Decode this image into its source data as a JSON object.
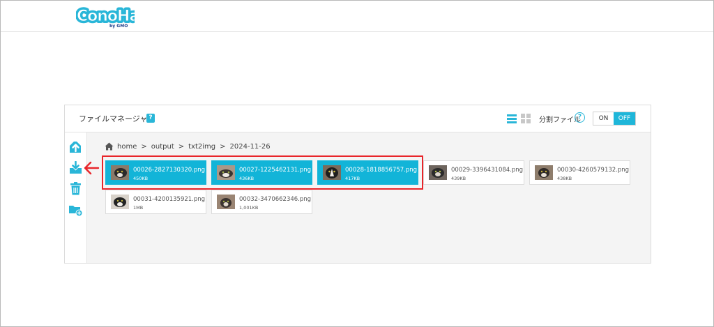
{
  "brand": {
    "logo_text": "ConoHa",
    "logo_sub": "by GMO",
    "color": "#29b6d8"
  },
  "panel": {
    "title": "ファイルマネージャー",
    "help_glyph": "?",
    "split_label": "分割ファイル",
    "split_help_glyph": "?",
    "toggle": {
      "on_label": "ON",
      "off_label": "OFF",
      "selected": "OFF"
    }
  },
  "sidebar": {
    "buttons": [
      {
        "name": "upload-icon",
        "active": false
      },
      {
        "name": "download-icon",
        "active": true
      },
      {
        "name": "trash-icon",
        "active": false
      },
      {
        "name": "new-folder-icon",
        "active": false
      }
    ]
  },
  "breadcrumb": {
    "home_label": "home",
    "sep": ">",
    "items": [
      "output",
      "txt2img",
      "2024-11-26"
    ]
  },
  "files": [
    {
      "name": "00026-2827130320.png",
      "size": "450KB",
      "selected": true
    },
    {
      "name": "00027-1225462131.png",
      "size": "436KB",
      "selected": true
    },
    {
      "name": "00028-1818856757.png",
      "size": "417KB",
      "selected": true
    },
    {
      "name": "00029-3396431084.png",
      "size": "439KB",
      "selected": false
    },
    {
      "name": "00030-4260579132.png",
      "size": "438KB",
      "selected": false
    },
    {
      "name": "00031-4200135921.png",
      "size": "1MB",
      "selected": false
    },
    {
      "name": "00032-3470662346.png",
      "size": "1,001KB",
      "selected": false
    }
  ],
  "colors": {
    "accent": "#12b4d8",
    "annotation": "#e8252a"
  }
}
